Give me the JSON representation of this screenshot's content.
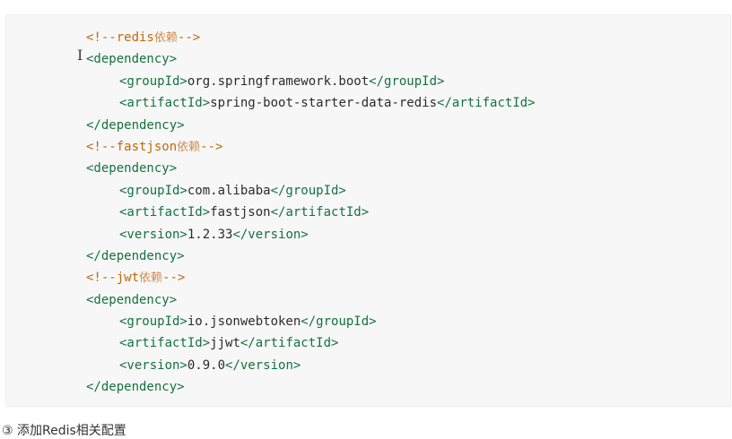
{
  "code": {
    "lines": [
      {
        "type": "comment",
        "open": "<!--",
        "name": "redis",
        "cjk": "依赖",
        "close": "-->"
      },
      {
        "type": "tag",
        "indent": 0,
        "open": "<dependency>"
      },
      {
        "type": "element",
        "indent": 1,
        "open": "<groupId>",
        "value": "org.springframework.boot",
        "close": "</groupId>"
      },
      {
        "type": "element",
        "indent": 1,
        "open": "<artifactId>",
        "value": "spring-boot-starter-data-redis",
        "close": "</artifactId>"
      },
      {
        "type": "tag",
        "indent": 0,
        "open": "</dependency>"
      },
      {
        "type": "comment",
        "open": "<!--",
        "name": "fastjson",
        "cjk": "依赖",
        "close": "-->"
      },
      {
        "type": "tag",
        "indent": 0,
        "open": "<dependency>"
      },
      {
        "type": "element",
        "indent": 1,
        "open": "<groupId>",
        "value": "com.alibaba",
        "close": "</groupId>"
      },
      {
        "type": "element",
        "indent": 1,
        "open": "<artifactId>",
        "value": "fastjson",
        "close": "</artifactId>"
      },
      {
        "type": "element",
        "indent": 1,
        "open": "<version>",
        "value": "1.2.33",
        "close": "</version>"
      },
      {
        "type": "tag",
        "indent": 0,
        "open": "</dependency>"
      },
      {
        "type": "comment",
        "open": "<!--",
        "name": "jwt",
        "cjk": "依赖",
        "close": "-->"
      },
      {
        "type": "tag",
        "indent": 0,
        "open": "<dependency>"
      },
      {
        "type": "element",
        "indent": 1,
        "open": "<groupId>",
        "value": "io.jsonwebtoken",
        "close": "</groupId>"
      },
      {
        "type": "element",
        "indent": 1,
        "open": "<artifactId>",
        "value": "jjwt",
        "close": "</artifactId>"
      },
      {
        "type": "element",
        "indent": 1,
        "open": "<version>",
        "value": "0.9.0",
        "close": "</version>"
      },
      {
        "type": "tag",
        "indent": 0,
        "open": "</dependency>"
      }
    ]
  },
  "cursor": {
    "icon": "text-cursor-icon",
    "glyph": "I"
  },
  "footer": {
    "text": "③ 添加Redis相关配置"
  },
  "colors": {
    "tag": "#14723e",
    "comment": "#c2680c",
    "text": "#2b2b2b",
    "background": "#f7f7f8"
  }
}
